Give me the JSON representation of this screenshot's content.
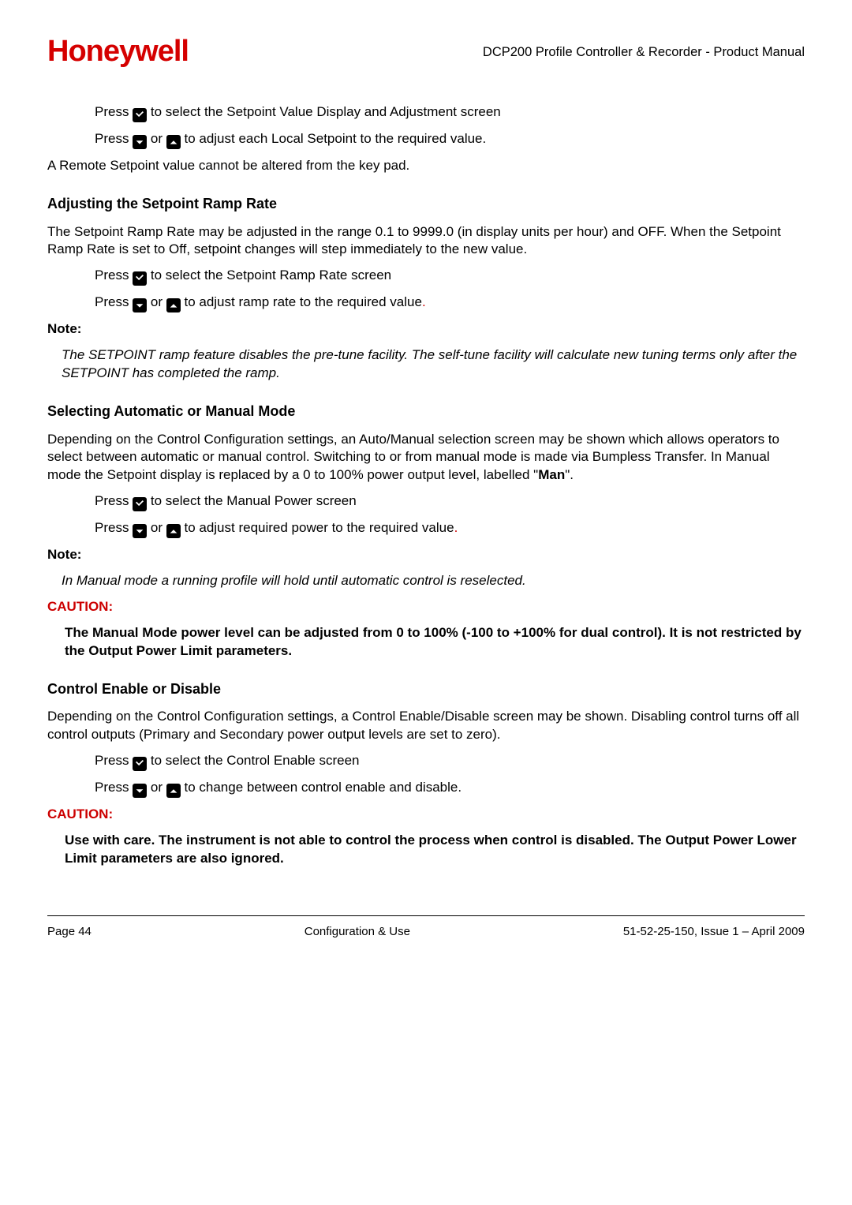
{
  "header": {
    "logo": "Honeywell",
    "doc_title": "DCP200 Profile Controller & Recorder - Product Manual"
  },
  "sec1": {
    "line1a": "Press ",
    "line1b": "  to select the Setpoint Value Display and Adjustment screen",
    "line2a": "Press ",
    "line2b": " or ",
    "line2c": " to adjust each Local Setpoint to the required value.",
    "line3": "A Remote Setpoint value cannot be altered from the key pad."
  },
  "sec2": {
    "heading": "Adjusting the Setpoint Ramp Rate",
    "p1": "The Setpoint Ramp Rate may be adjusted in the range 0.1 to 9999.0 (in display units per hour) and OFF. When the Setpoint Ramp Rate is set to Off, setpoint changes will step immediately to the new value.",
    "line1a": "Press ",
    "line1b": "  to select the Setpoint Ramp Rate screen",
    "line2a": "Press ",
    "line2b": " or ",
    "line2c": " to adjust ramp rate to the required value",
    "period": ".",
    "note_label": "Note:",
    "note_body": "The SETPOINT ramp feature disables the pre-tune facility. The self-tune facility will calculate new tuning terms only after the SETPOINT has completed the ramp."
  },
  "sec3": {
    "heading": "Selecting Automatic or Manual Mode",
    "p1a": "Depending on the Control Configuration settings, an Auto/Manual selection screen may be shown which allows operators to select between automatic or manual control. Switching to or from manual mode is made via Bumpless Transfer. In Manual mode the Setpoint display is replaced by a 0 to 100% power output level, labelled \"",
    "man": "Man",
    "p1b": "\".",
    "line1a": "Press ",
    "line1b": "  to select the Manual Power screen",
    "line2a": "Press ",
    "line2b": " or ",
    "line2c": " to adjust required power to the required value",
    "period": ".",
    "note_label": "Note:",
    "note_body": "In Manual mode a running profile will hold until automatic control is reselected.",
    "caution_label": "CAUTION:",
    "caution_body": "The Manual Mode power level can be adjusted from 0 to 100% (-100 to +100% for dual control). It is not restricted by the Output Power Limit parameters."
  },
  "sec4": {
    "heading": "Control Enable or Disable",
    "p1": "Depending on the Control Configuration settings, a Control Enable/Disable screen may be shown. Disabling control turns off all control outputs (Primary and Secondary power output levels are set to zero).",
    "line1a": "Press ",
    "line1b": "  to select the Control Enable screen",
    "line2a": "Press ",
    "line2b": " or ",
    "line2c": " to change between control enable and disable.",
    "caution_label": "CAUTION:",
    "caution_body": "Use with care. The instrument is not able to control the process when control is disabled. The Output Power Lower Limit parameters are also ignored."
  },
  "footer": {
    "left": "Page 44",
    "center": "Configuration & Use",
    "right": "51-52-25-150, Issue 1 – April 2009"
  }
}
